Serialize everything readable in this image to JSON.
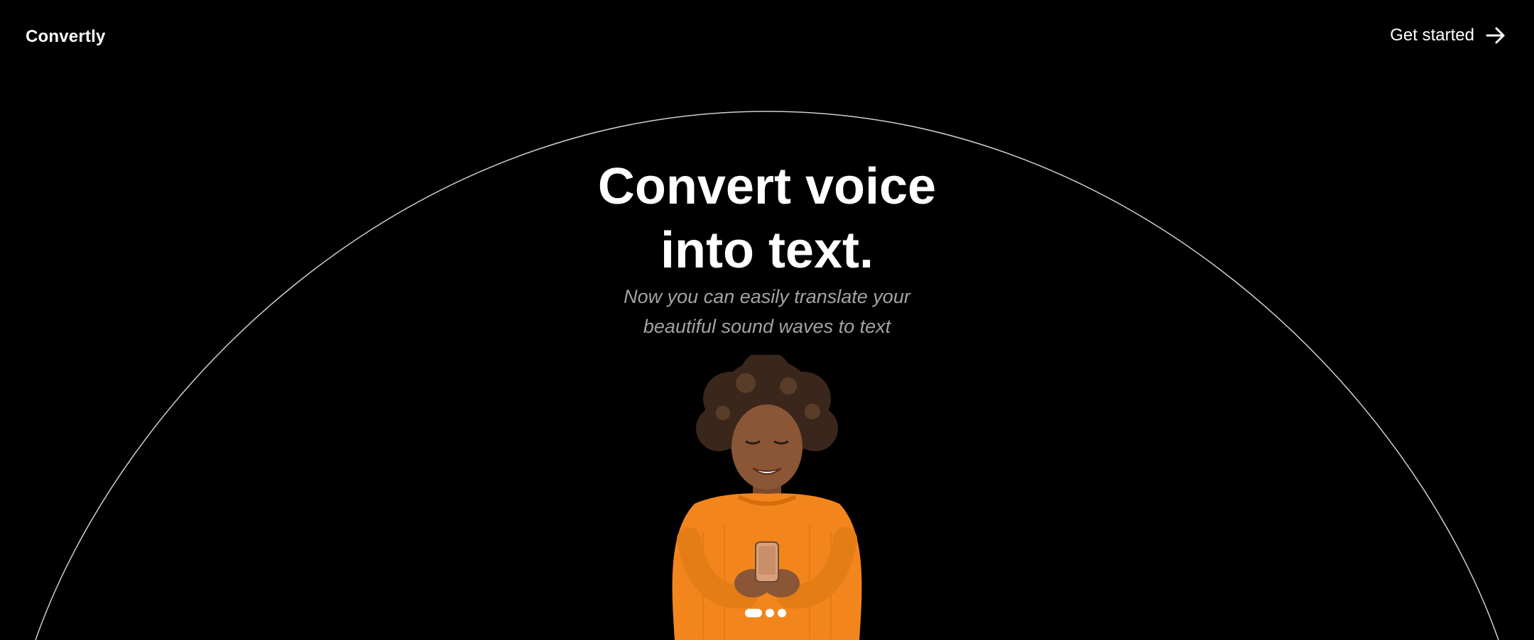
{
  "header": {
    "brand": "Convertly",
    "cta_label": "Get started",
    "cta_icon": "arrow-right-icon"
  },
  "hero": {
    "title_line1": "Convert voice",
    "title_line2": "into text.",
    "subtitle_line1": "Now you can easily translate your",
    "subtitle_line2": "beautiful sound waves to text",
    "image": "woman-with-phone-illustration"
  },
  "carousel": {
    "slides": 3,
    "active_index": 0
  },
  "colors": {
    "background": "#000000",
    "text": "#ffffff",
    "subtitle": "#a3a3a3",
    "arc": "#cfcfcf",
    "sweater": "#f2861c"
  }
}
